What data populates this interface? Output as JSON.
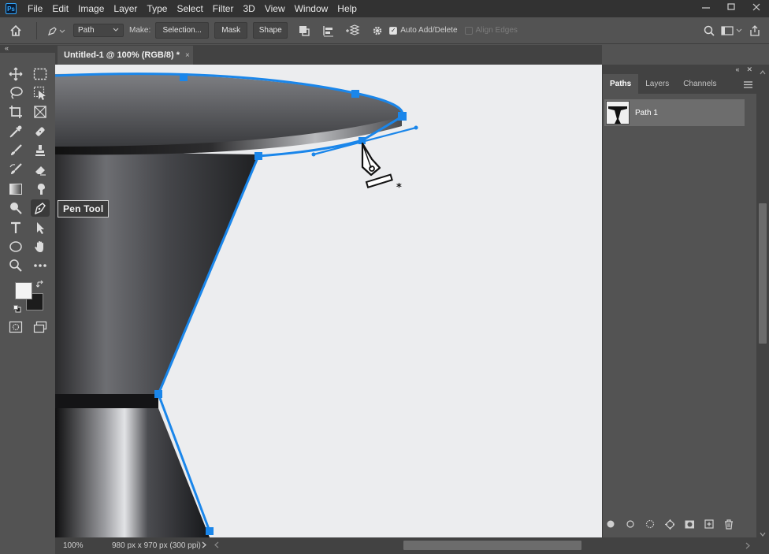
{
  "app": {
    "logo_text": "Ps"
  },
  "menu": [
    "File",
    "Edit",
    "Image",
    "Layer",
    "Type",
    "Select",
    "Filter",
    "3D",
    "View",
    "Window",
    "Help"
  ],
  "options": {
    "mode_value": "Path",
    "make_label": "Make:",
    "selection_button": "Selection...",
    "mask_button": "Mask",
    "shape_button": "Shape",
    "auto_add_delete_label": "Auto Add/Delete",
    "auto_add_delete_checked": true,
    "align_edges_label": "Align Edges",
    "align_edges_checked": false
  },
  "document": {
    "tab_title": "Untitled-1 @ 100% (RGB/8) *",
    "tab_close": "×"
  },
  "toolbar": {
    "tooltip": "Pen Tool",
    "active_tool": "pen-tool"
  },
  "status": {
    "zoom": "100%",
    "doc_info": "980 px x 970 px (300 ppi)"
  },
  "panels": {
    "tabs": [
      "Paths",
      "Layers",
      "Channels"
    ],
    "active_tab": "Paths",
    "paths": [
      {
        "name": "Path 1"
      }
    ]
  },
  "colors": {
    "accent": "#1a86ea",
    "menubar": "#323232",
    "panel": "#535353",
    "canvas": "#ecedef"
  }
}
